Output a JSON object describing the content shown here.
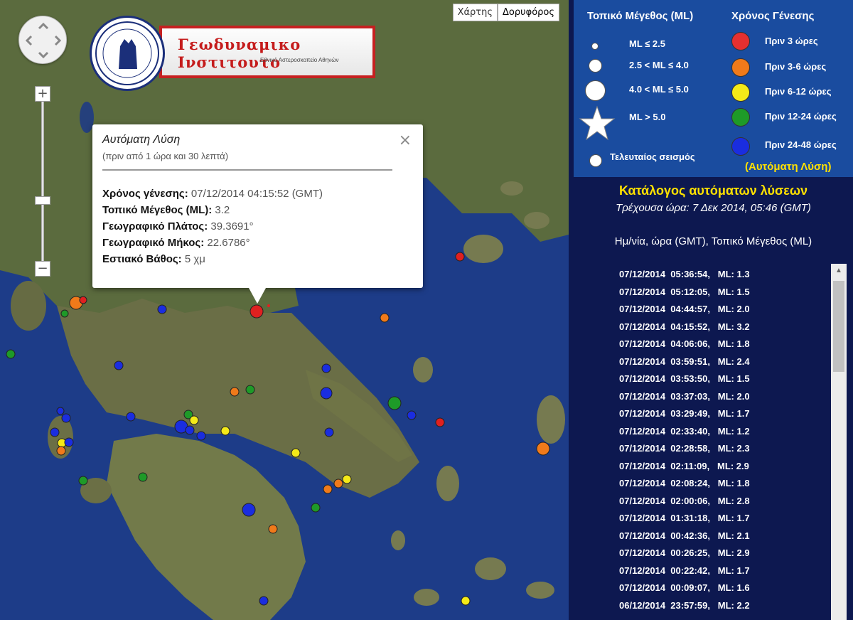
{
  "map": {
    "maptype": {
      "map_label": "Χάρτης",
      "satellite_label": "Δορυφόρος",
      "active": "satellite"
    },
    "zoom": {
      "in_label": "+",
      "out_label": "−"
    },
    "logo": {
      "title": "Γεωδυναμικο Ινστιτουτο",
      "subtitle": "Εθνικό Αστεροσκοπείο Αθηνών",
      "seal_icon": "observatory-seal-icon"
    },
    "popup": {
      "title": "Αυτόματη Λύση",
      "subtitle": "(πριν από 1 ώρα και 30 λεπτά)",
      "close": "×",
      "fields": [
        {
          "label": "Χρόνος γένεσης:",
          "value": "07/12/2014  04:15:52 (GMT)"
        },
        {
          "label": "Τοπικό Μέγεθος (ML):",
          "value": "3.2"
        },
        {
          "label": "Γεωγραφικό Πλάτος:",
          "value": "39.3691°"
        },
        {
          "label": "Γεωγραφικό Μήκος:",
          "value": "22.6786°"
        },
        {
          "label": "Εστιακό Βάθος:",
          "value": "5 χμ"
        }
      ]
    }
  },
  "legend": {
    "magnitude_title": "Τοπικό Μέγεθος (ML)",
    "time_title": "Χρόνος Γένεσης",
    "magnitudes": [
      {
        "label": "ML ≤ 2.5"
      },
      {
        "label": "2.5 < ML ≤ 4.0"
      },
      {
        "label": "4.0 < ML ≤ 5.0"
      },
      {
        "label": "ML > 5.0"
      },
      {
        "label": "Τελευταίος σεισμός"
      }
    ],
    "times": [
      {
        "label": "Πριν 3 ώρες",
        "color": "#e53030"
      },
      {
        "label": "Πριν 3-6 ώρες",
        "color": "#f07a1a"
      },
      {
        "label": "Πριν 6-12 ώρες",
        "color": "#f4ea18"
      },
      {
        "label": "Πριν 12-24 ώρες",
        "color": "#1e9a28"
      },
      {
        "label": "Πριν 24-48 ώρες",
        "color": "#1a2de0"
      }
    ],
    "auto_label": "(Αυτόματη Λύση)"
  },
  "catalog": {
    "title": "Κατάλογος αυτόματων λύσεων",
    "current_time": "Τρέχουσα ώρα: 7 Δεκ 2014, 05:46 (GMT)",
    "header": "Ημ/νία, ώρα (GMT), Τοπικό Μέγεθος (ML)",
    "rows": [
      "07/12/2014  05:36:54,   ML: 1.3",
      "07/12/2014  05:12:05,   ML: 1.5",
      "07/12/2014  04:44:57,   ML: 2.0",
      "07/12/2014  04:15:52,   ML: 3.2",
      "07/12/2014  04:06:06,   ML: 1.8",
      "07/12/2014  03:59:51,   ML: 2.4",
      "07/12/2014  03:53:50,   ML: 1.5",
      "07/12/2014  03:37:03,   ML: 2.0",
      "07/12/2014  03:29:49,   ML: 1.7",
      "07/12/2014  02:33:40,   ML: 1.2",
      "07/12/2014  02:28:58,   ML: 2.3",
      "07/12/2014  02:11:09,   ML: 2.9",
      "07/12/2014  02:08:24,   ML: 1.8",
      "07/12/2014  02:00:06,   ML: 2.8",
      "07/12/2014  01:31:18,   ML: 1.7",
      "07/12/2014  00:42:36,   ML: 2.1",
      "07/12/2014  00:26:25,   ML: 2.9",
      "07/12/2014  00:22:42,   ML: 1.7",
      "07/12/2014  00:09:07,   ML: 1.6",
      "06/12/2014  23:57:59,   ML: 2.2"
    ]
  }
}
